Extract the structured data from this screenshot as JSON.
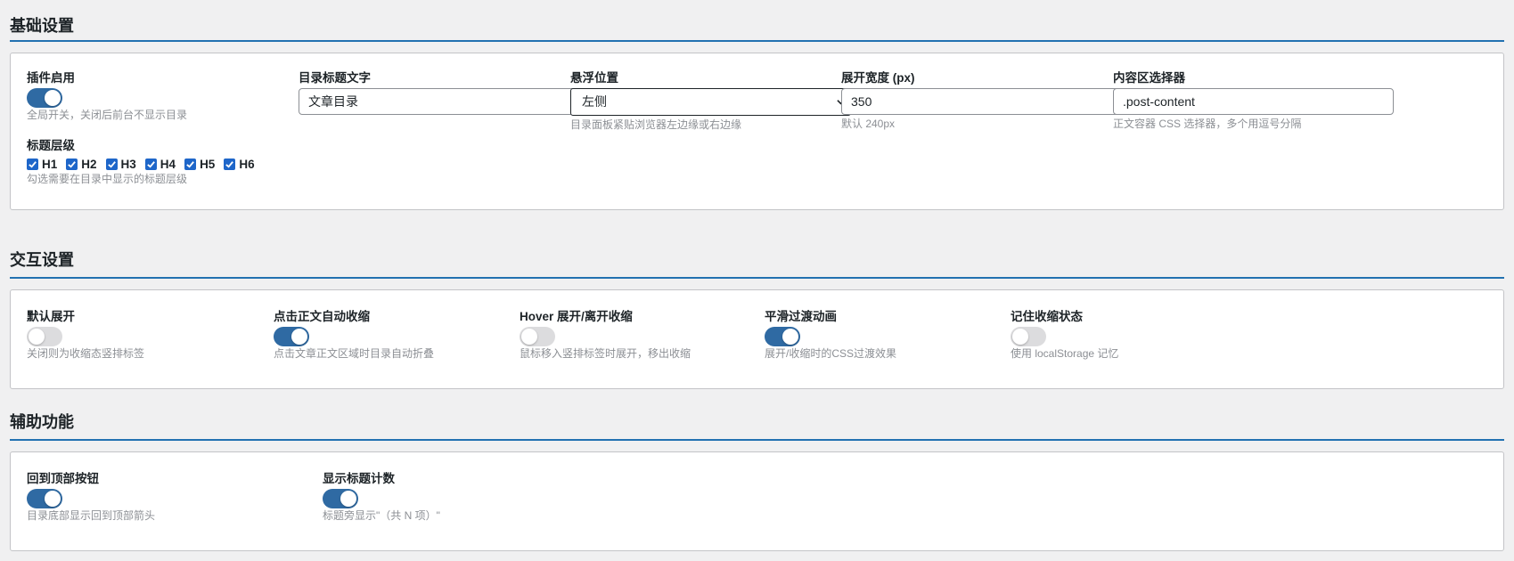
{
  "colors": {
    "accent": "#2271b1",
    "toggle_on": "#2f6aa3",
    "toggle_off": "#dcdcde",
    "checkbox": "#1e66c9"
  },
  "basic": {
    "title": "基础设置",
    "enable": {
      "label": "插件启用",
      "on": true,
      "desc": "全局开关，关闭后前台不显示目录"
    },
    "toc_title": {
      "label": "目录标题文字",
      "value": "文章目录"
    },
    "position": {
      "label": "悬浮位置",
      "value": "左侧",
      "desc": "目录面板紧贴浏览器左边缘或右边缘",
      "icon": "chevron-down-icon"
    },
    "width": {
      "label": "展开宽度 (px)",
      "value": "350",
      "desc": "默认 240px"
    },
    "selector": {
      "label": "内容区选择器",
      "value": ".post-content",
      "desc": "正文容器 CSS 选择器，多个用逗号分隔"
    },
    "levels": {
      "label": "标题层级",
      "items": [
        {
          "label": "H1",
          "checked": true
        },
        {
          "label": "H2",
          "checked": true
        },
        {
          "label": "H3",
          "checked": true
        },
        {
          "label": "H4",
          "checked": true
        },
        {
          "label": "H5",
          "checked": true
        },
        {
          "label": "H6",
          "checked": true
        }
      ],
      "desc": "勾选需要在目录中显示的标题层级"
    }
  },
  "interaction": {
    "title": "交互设置",
    "items": [
      {
        "label": "默认展开",
        "on": false,
        "desc": "关闭则为收缩态竖排标签"
      },
      {
        "label": "点击正文自动收缩",
        "on": true,
        "desc": "点击文章正文区域时目录自动折叠"
      },
      {
        "label": "Hover 展开/离开收缩",
        "on": false,
        "desc": "鼠标移入竖排标签时展开，移出收缩"
      },
      {
        "label": "平滑过渡动画",
        "on": true,
        "desc": "展开/收缩时的CSS过渡效果"
      },
      {
        "label": "记住收缩状态",
        "on": false,
        "desc": "使用 localStorage 记忆"
      }
    ]
  },
  "aux": {
    "title": "辅助功能",
    "items": [
      {
        "label": "回到顶部按钮",
        "on": true,
        "desc": "目录底部显示回到顶部箭头"
      },
      {
        "label": "显示标题计数",
        "on": true,
        "desc": "标题旁显示\"（共 N 项）\""
      }
    ]
  }
}
